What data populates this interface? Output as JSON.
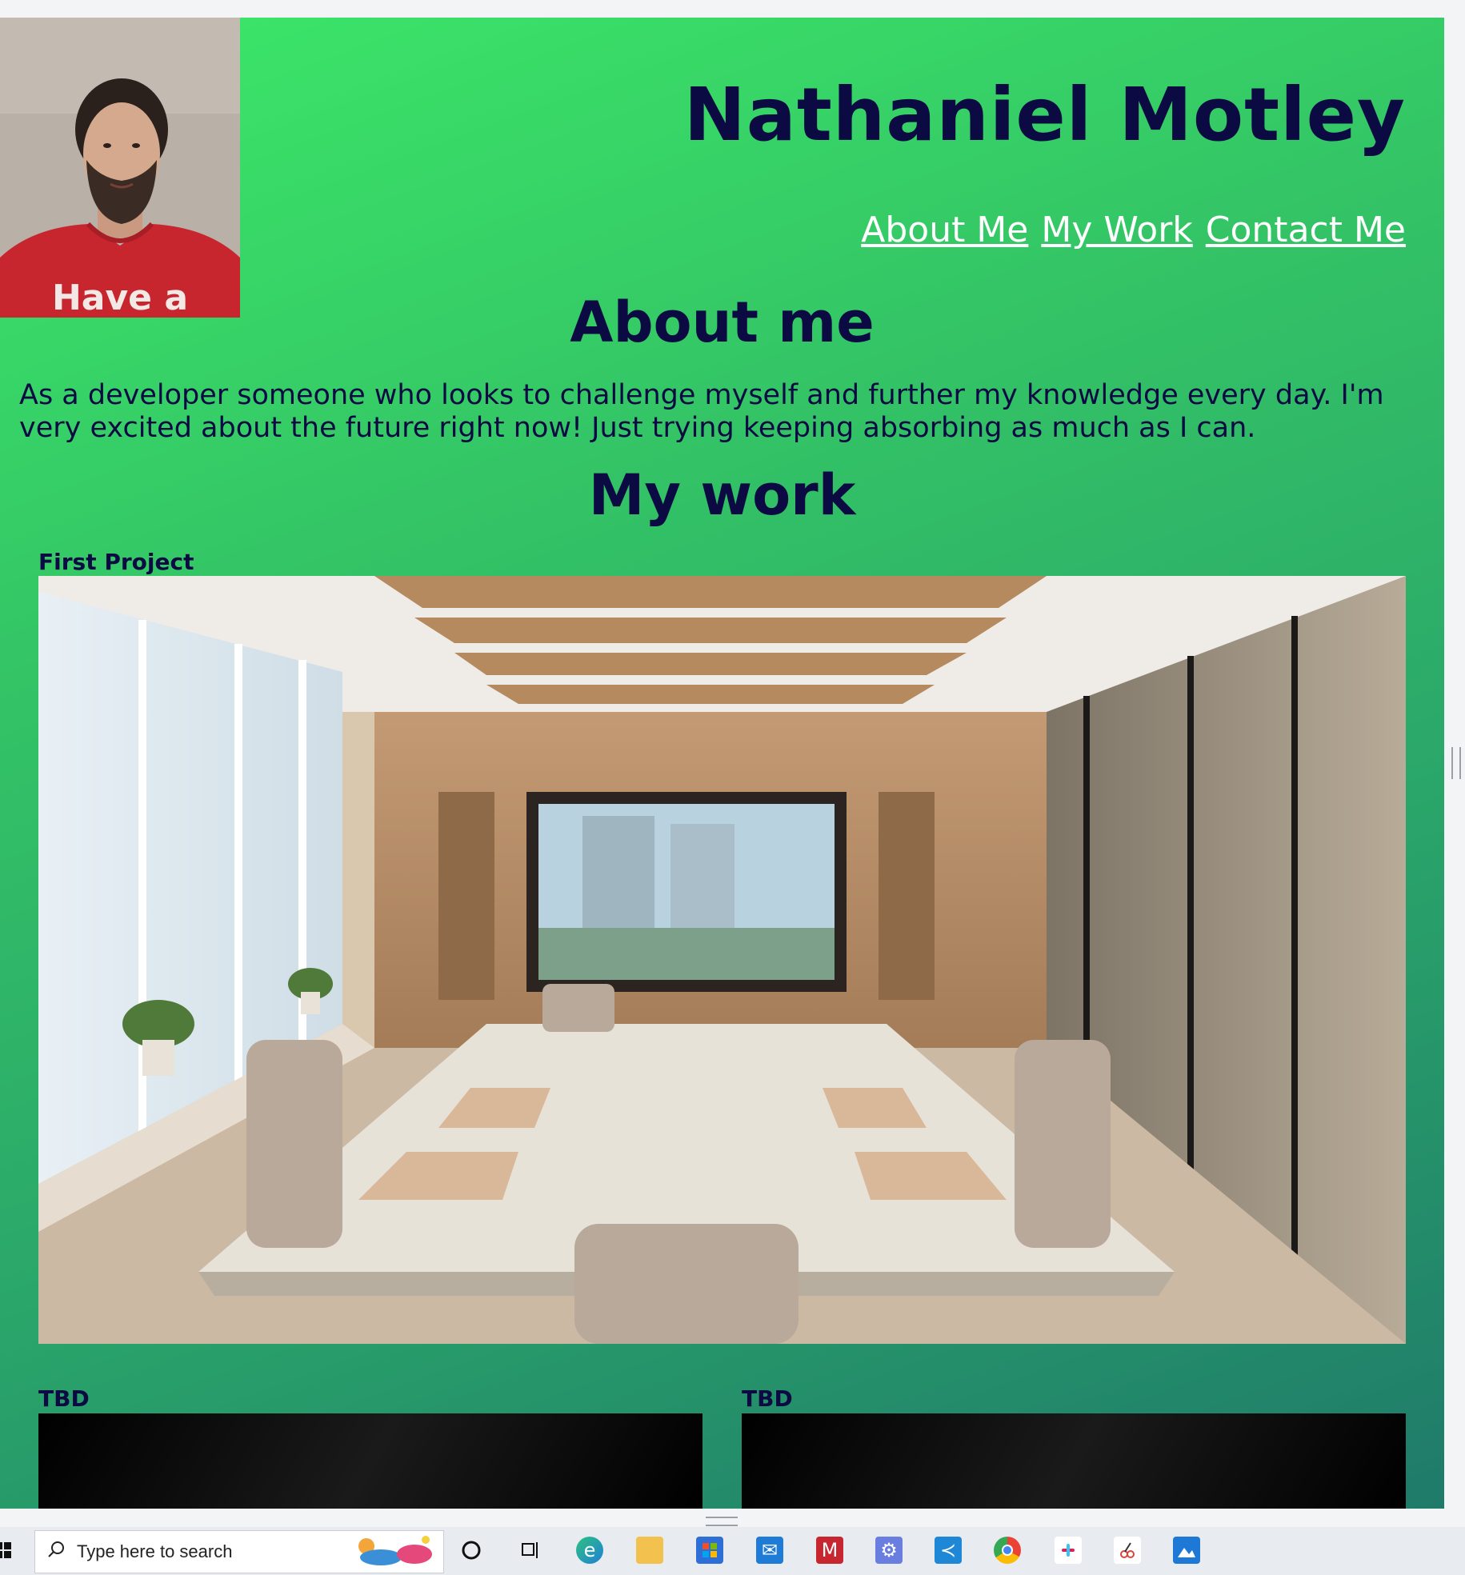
{
  "header": {
    "name": "Nathaniel Motley",
    "shirt_text": "Have a"
  },
  "nav": {
    "items": [
      "About Me",
      "My Work",
      "Contact Me"
    ]
  },
  "about": {
    "heading": "About me",
    "text": "As a developer someone who looks to challenge myself and further my knowledge every day. I'm very excited about the future right now! Just trying keeping absorbing as much as I can."
  },
  "work": {
    "heading": "My work",
    "first_project_label": "First Project",
    "tbd_labels": [
      "TBD",
      "TBD"
    ]
  },
  "taskbar": {
    "search_placeholder": "Type here to search"
  },
  "colors": {
    "heading": "#0b0a42",
    "nav_link": "#ffffff",
    "gradient_start": "#3ce868",
    "gradient_end": "#1f7a6a"
  }
}
